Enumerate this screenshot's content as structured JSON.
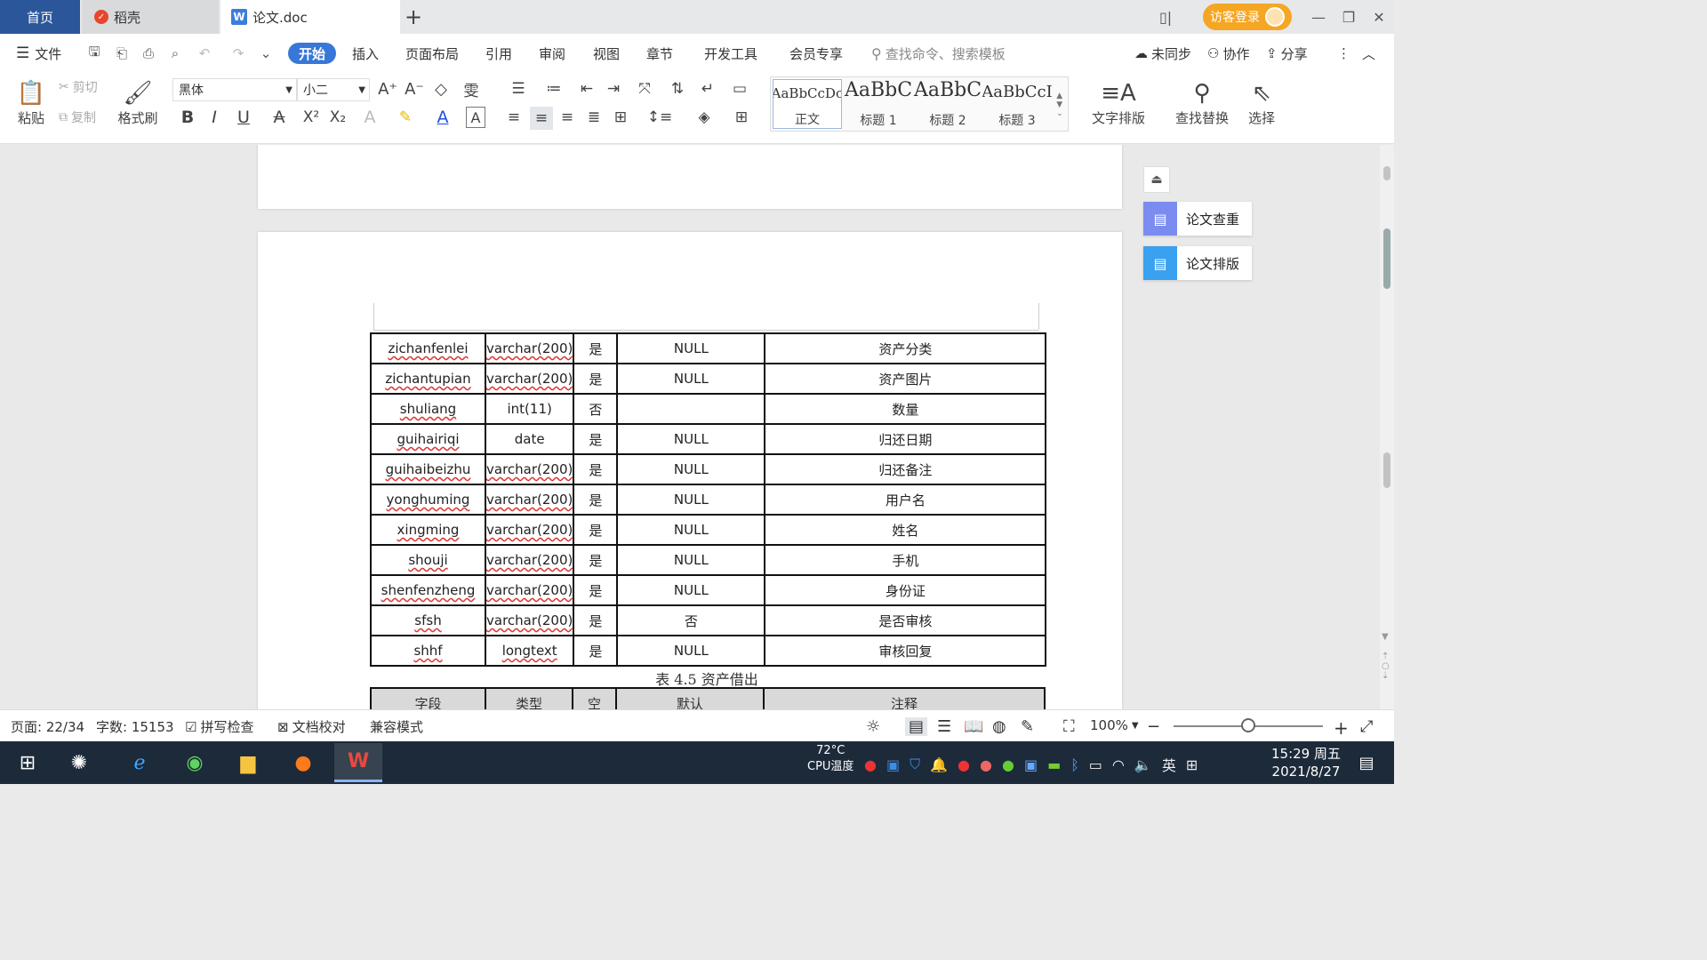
{
  "tabs": {
    "home": "首页",
    "daoke": "稻壳",
    "doc": "论文.doc",
    "add": "+"
  },
  "titlebar": {
    "login": "访客登录"
  },
  "menu": {
    "file": "文件",
    "items": [
      "开始",
      "插入",
      "页面布局",
      "引用",
      "审阅",
      "视图",
      "章节",
      "开发工具",
      "会员专享"
    ],
    "search_placeholder": "查找命令、搜索模板",
    "sync": "未同步",
    "collab": "协作",
    "share": "分享"
  },
  "ribbon": {
    "paste": "粘贴",
    "cut": "剪切",
    "copy": "复制",
    "format_painter": "格式刷",
    "font_name": "黑体",
    "font_size": "小二",
    "styles": [
      {
        "sample": "AaBbCcDc",
        "name": "正文"
      },
      {
        "sample": "AaBbC",
        "name": "标题 1"
      },
      {
        "sample": "AaBbC",
        "name": "标题 2"
      },
      {
        "sample": "AaBbCcI",
        "name": "标题 3"
      }
    ],
    "text_layout": "文字排版",
    "find_replace": "查找替换",
    "select": "选择"
  },
  "sidepanel": {
    "check": "论文查重",
    "format": "论文排版"
  },
  "table": {
    "rows": [
      [
        "zichanfenlei",
        "varchar(200)",
        "是",
        "NULL",
        "资产分类"
      ],
      [
        "zichantupian",
        "varchar(200)",
        "是",
        "NULL",
        "资产图片"
      ],
      [
        "shuliang",
        "int(11)",
        "否",
        "",
        "数量"
      ],
      [
        "guihairiqi",
        "date",
        "是",
        "NULL",
        "归还日期"
      ],
      [
        "guihaibeizhu",
        "varchar(200)",
        "是",
        "NULL",
        "归还备注"
      ],
      [
        "yonghuming",
        "varchar(200)",
        "是",
        "NULL",
        "用户名"
      ],
      [
        "xingming",
        "varchar(200)",
        "是",
        "NULL",
        "姓名"
      ],
      [
        "shouji",
        "varchar(200)",
        "是",
        "NULL",
        "手机"
      ],
      [
        "shenfenzheng",
        "varchar(200)",
        "是",
        "NULL",
        "身份证"
      ],
      [
        "sfsh",
        "varchar(200)",
        "是",
        "否",
        "是否审核"
      ],
      [
        "shhf",
        "longtext",
        "是",
        "NULL",
        "审核回复"
      ]
    ],
    "caption": "表 4.5 资产借出",
    "next_header": [
      "字段",
      "类型",
      "空",
      "默认",
      "注释"
    ]
  },
  "status": {
    "page": "页面: 22/34",
    "words": "字数: 15153",
    "spell": "拼写检查",
    "proof": "文档校对",
    "compat": "兼容模式",
    "zoom": "100%",
    "zoom_level": 0.5
  },
  "taskbar": {
    "cpu_temp": "72°C",
    "cpu_label": "CPU温度",
    "ime": "英",
    "time": "15:29 周五",
    "date": "2021/8/27"
  }
}
